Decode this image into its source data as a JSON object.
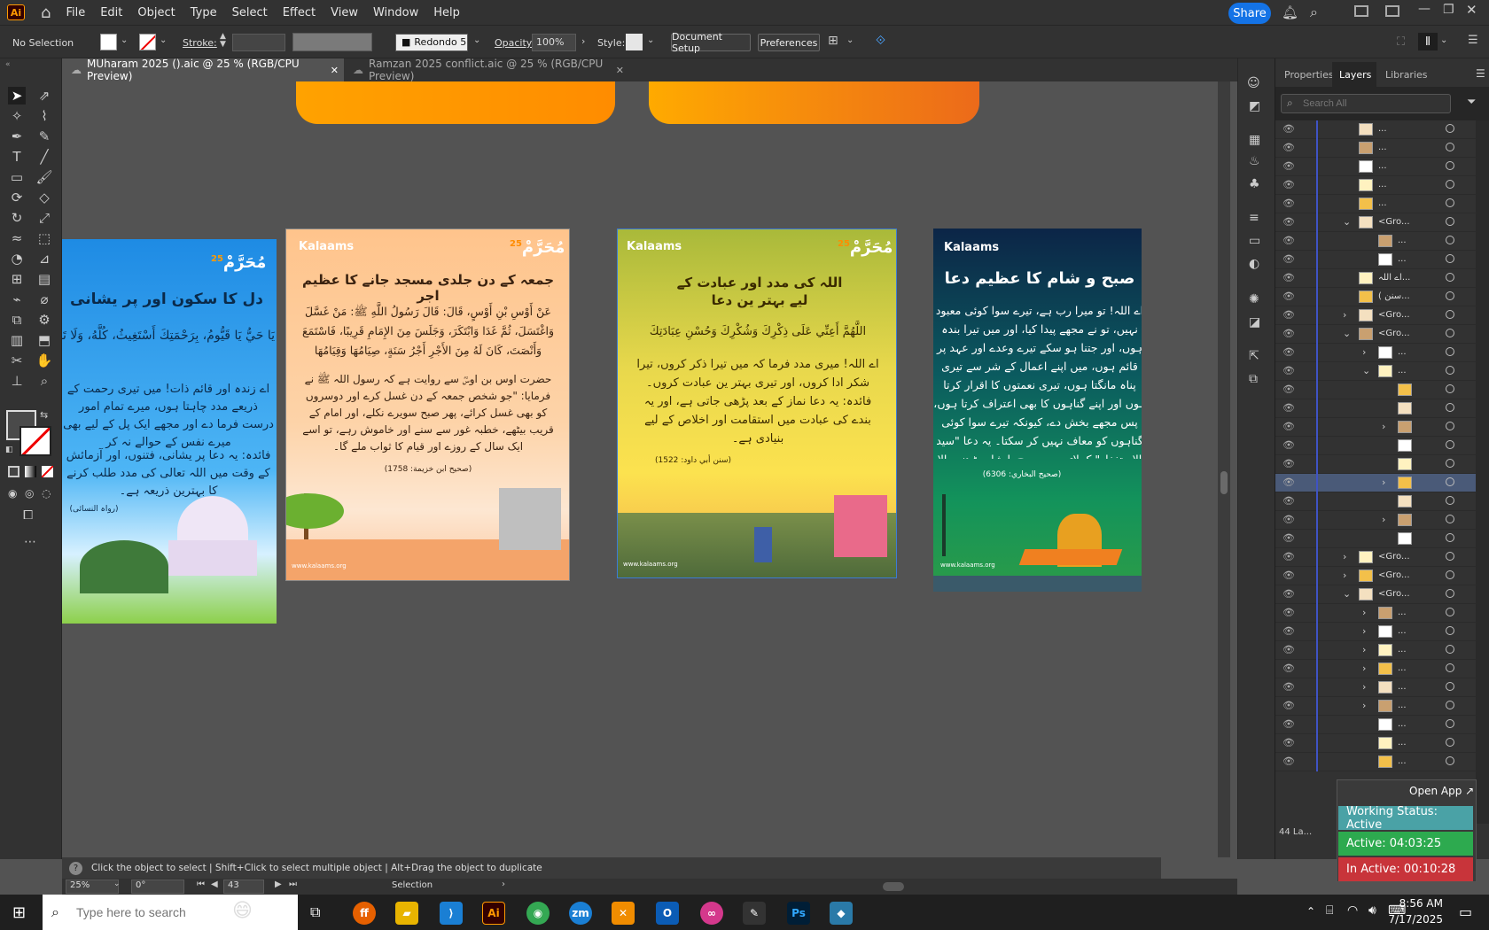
{
  "menubar": {
    "app_logo": "Ai",
    "items": [
      "File",
      "Edit",
      "Object",
      "Type",
      "Select",
      "Effect",
      "View",
      "Window",
      "Help"
    ],
    "share_label": "Share"
  },
  "control_bar": {
    "selection": "No Selection",
    "stroke_label": "Stroke:",
    "brush": "Redondo 5 ...",
    "opacity_label": "Opacity:",
    "opacity_value": "100%",
    "style_label": "Style:",
    "document_setup": "Document Setup",
    "preferences": "Preferences"
  },
  "tabs": [
    {
      "label": "MUharam 2025 ().aic @ 25 % (RGB/CPU Preview)",
      "active": true
    },
    {
      "label": "Ramzan 2025 conflict.aic @ 25 % (RGB/CPU Preview)",
      "active": false
    }
  ],
  "artboards": [
    {
      "heading": "دل کا سکون اور پر یشانی",
      "arabic": "يَا حَيُّ يَا قَيُّومُ، بِرَحْمَتِكَ أَسْتَغِيثُ، كُلَّهُ، وَلَا تَكِلْنِي إِلَى نَفْسِي طَرْفَةَ",
      "body": "اے زندہ اور قائم ذات! میں تیری رحمت کے ذریعے مدد چاہتا ہوں، میرے تمام امور درست فرما دے اور مجھے ایک پل کے لیے بھی میرے نفس کے حوالے نہ کر",
      "benefit": "فائدہ: یہ دعا پر یشانی، فتنوں، اور آزمائش کے وقت میں اللہ تعالی کی مدد طلب کرنے کا بہترین ذریعہ ہے۔",
      "source": "(رواہ النسائی)",
      "badge": "25"
    },
    {
      "logo": "Kalaams",
      "heading": "جمعہ کے دن جلدی مسجد جانے کا عظیم اجر",
      "arabic": "عَنْ أَوْسِ بْنِ أَوْسٍ، قَالَ: قَالَ رَسُولُ اللَّهِ ﷺ: مَنْ غَسَّلَ وَاغْتَسَلَ، ثُمَّ غَدَا وَابْتَكَرَ، وَجَلَسَ مِنَ الإِمَامِ قَرِيبًا، فَاسْتَمَعَ وَأَنْصَتَ، كَانَ لَهُ مِنَ الأَجْرِ أَجْرُ سَنَةٍ، صِيَامُهَا وَقِيَامُهَا",
      "body": "حضرت اوس بن اوسؓ سے روایت ہے کہ رسول اللہ ﷺ نے فرمایا: \"جو شخص جمعہ کے دن غسل کرے اور دوسروں کو بھی غسل کرائے، پھر صبح سویرے نکلے، اور امام کے قریب بیٹھے، خطبہ غور سے سنے اور خاموش رہے، تو اسے ایک سال کے روزے اور قیام کا ثواب ملے گا۔",
      "source": "(صحیح ابن خزیمة: 1758)",
      "website": "www.kalaams.org",
      "badge": "25"
    },
    {
      "logo": "Kalaams",
      "heading": "اللہ کی مدد اور عبادت کے لیے بہتر ین دعا",
      "arabic": "اللَّهُمَّ أَعِنِّي عَلَى ذِكْرِكَ وَشُكْرِكَ وَحُسْنِ عِبَادَتِكَ",
      "body": "اے اللہ! میری مدد فرما کہ میں تیرا ذکر کروں، تیرا شکر ادا کروں، اور تیری بہتر ین عبادت کروں۔ فائدہ: یہ دعا نماز کے بعد پڑھی جاتی ہے، اور یہ بندے کی عبادت میں استقامت اور اخلاص کے لیے بنیادی ہے۔",
      "source": "(سنن أبي داود: 1522)",
      "website": "www.kalaams.org",
      "badge": "25"
    },
    {
      "logo": "Kalaams",
      "heading": "صبح و شام کا عظیم دعا",
      "body": "اے اللہ! تو میرا رب ہے، تیرے سوا کوئی معبود نہیں، تو نے مجھے پیدا کیا، اور میں تیرا بندہ ہوں، اور جتنا ہو سکے تیرے وعدے اور عہد پر قائم ہوں، میں اپنے اعمال کے شر سے تیری پناہ مانگتا ہوں، تیری نعمتوں کا اقرار کرتا ہوں اور اپنے گناہوں کا بھی اعتراف کرتا ہوں، پس مجھے بخش دے، کیونکہ تیرے سوا کوئی گناہوں کو معاف نہیں کر سکتا۔ یہ دعا \"سید الاستغفار\" کہلاتی ہے، صبح یا شام پڑھنے والا شخص جنت کا حق دار بن جاتا ہے اگر اس دن یا رات میں فوت ہو جائے۔",
      "source": "(صحیح البخاري: 6306)",
      "website": "www.kalaams.org"
    }
  ],
  "panel": {
    "tabs": [
      "Properties",
      "Layers",
      "Libraries"
    ],
    "active_tab": "Layers",
    "search_placeholder": "Search All",
    "layer_count": "44 La...",
    "rows": [
      {
        "name": "...",
        "indent": 0,
        "expander": ""
      },
      {
        "name": "...",
        "indent": 0,
        "expander": ""
      },
      {
        "name": "...",
        "indent": 0,
        "expander": ""
      },
      {
        "name": "...",
        "indent": 0,
        "expander": ""
      },
      {
        "name": "...",
        "indent": 0,
        "expander": ""
      },
      {
        "name": "<Gro...",
        "indent": 0,
        "expander": "⌄"
      },
      {
        "name": "...",
        "indent": 1,
        "expander": ""
      },
      {
        "name": "...",
        "indent": 1,
        "expander": ""
      },
      {
        "name": "اے اللہ...",
        "indent": 0,
        "expander": ""
      },
      {
        "name": "( سنن...",
        "indent": 0,
        "expander": ""
      },
      {
        "name": "<Gro...",
        "indent": 0,
        "expander": "›"
      },
      {
        "name": "<Gro...",
        "indent": 0,
        "expander": "⌄"
      },
      {
        "name": "...",
        "indent": 1,
        "expander": "›"
      },
      {
        "name": "...",
        "indent": 1,
        "expander": "⌄"
      },
      {
        "name": "",
        "indent": 2,
        "expander": ""
      },
      {
        "name": "",
        "indent": 2,
        "expander": ""
      },
      {
        "name": "",
        "indent": 2,
        "expander": "›"
      },
      {
        "name": "",
        "indent": 2,
        "expander": ""
      },
      {
        "name": "",
        "indent": 2,
        "expander": ""
      },
      {
        "name": "",
        "indent": 2,
        "expander": "›"
      },
      {
        "name": "",
        "indent": 2,
        "expander": ""
      },
      {
        "name": "",
        "indent": 2,
        "expander": "›"
      },
      {
        "name": "",
        "indent": 2,
        "expander": ""
      },
      {
        "name": "<Gro...",
        "indent": 0,
        "expander": "›"
      },
      {
        "name": "<Gro...",
        "indent": 0,
        "expander": "›"
      },
      {
        "name": "<Gro...",
        "indent": 0,
        "expander": "⌄"
      },
      {
        "name": "...",
        "indent": 1,
        "expander": "›"
      },
      {
        "name": "...",
        "indent": 1,
        "expander": "›"
      },
      {
        "name": "...",
        "indent": 1,
        "expander": "›"
      },
      {
        "name": "...",
        "indent": 1,
        "expander": "›"
      },
      {
        "name": "...",
        "indent": 1,
        "expander": "›"
      },
      {
        "name": "...",
        "indent": 1,
        "expander": "›"
      },
      {
        "name": "...",
        "indent": 1,
        "expander": ""
      },
      {
        "name": "...",
        "indent": 1,
        "expander": ""
      },
      {
        "name": "...",
        "indent": 1,
        "expander": ""
      }
    ]
  },
  "hint_text": "Click the object to select  |  Shift+Click to select multiple object  |  Alt+Drag the object to duplicate",
  "statusbar": {
    "zoom": "25%",
    "rotation": "0°",
    "artboard_num": "43",
    "tool": "Selection"
  },
  "widgets": {
    "open_app": "Open App ↗",
    "working_status": "Working Status: Active",
    "active": "Active: 04:03:25",
    "inactive": "In Active: 00:10:28"
  },
  "taskbar": {
    "search_placeholder": "Type here to search",
    "time": "8:56 AM",
    "date": "7/17/2025"
  }
}
